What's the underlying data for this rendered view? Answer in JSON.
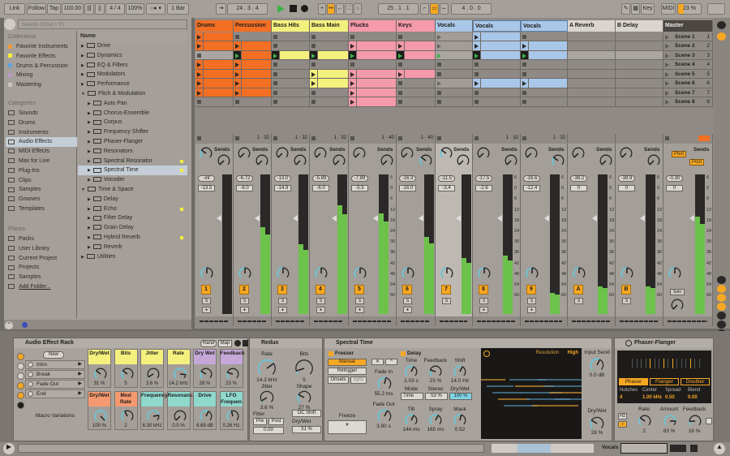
{
  "colors": {
    "orange": "#f36f24",
    "yellow": "#f4f07e",
    "pink": "#f59aaa",
    "blue": "#a9c7e8",
    "return": "#d9d4cf",
    "master": "#4b4642",
    "accent": "#f7a823",
    "meter": "#6cc24a"
  },
  "toolbar": {
    "link": "Link",
    "follow": "Follow",
    "tap": "Tap",
    "tempo": "100.00",
    "signature": "4 / 4",
    "zoom": "100%",
    "quantize": "1 Bar",
    "position": "24 .  3 .  4",
    "loop_start": "25 .  1 .  1",
    "loop_length": "4 .  0 .  0",
    "key": "Key",
    "midi": "MIDI",
    "cpu": "23 %"
  },
  "browser": {
    "search_placeholder": "Search (Cmd + F)",
    "collections_label": "Collections",
    "collections": [
      {
        "label": "Favorite Instruments",
        "color": "#f39a3a"
      },
      {
        "label": "Favorite Effects",
        "color": "#f3ee3a"
      },
      {
        "label": "Drums & Percussion",
        "color": "#5fa3d9"
      },
      {
        "label": "Mixing",
        "color": "#b79ac6"
      },
      {
        "label": "Mastering",
        "color": "#c9c3bd"
      }
    ],
    "categories_label": "Categories",
    "categories": [
      {
        "label": "Sounds",
        "icon": "note-icon"
      },
      {
        "label": "Drums",
        "icon": "grid-icon"
      },
      {
        "label": "Instruments",
        "icon": "clock-icon"
      },
      {
        "label": "Audio Effects",
        "icon": "waveform-icon",
        "selected": true
      },
      {
        "label": "MIDI Effects",
        "icon": "midi-icon"
      },
      {
        "label": "Max for Live",
        "icon": "max-icon"
      },
      {
        "label": "Plug-Ins",
        "icon": "plug-icon"
      },
      {
        "label": "Clips",
        "icon": "clip-icon"
      },
      {
        "label": "Samples",
        "icon": "sample-icon"
      },
      {
        "label": "Grooves",
        "icon": "groove-icon"
      },
      {
        "label": "Templates",
        "icon": "template-icon"
      }
    ],
    "places_label": "Places",
    "places": [
      {
        "label": "Packs"
      },
      {
        "label": "User Library"
      },
      {
        "label": "Current Project"
      },
      {
        "label": "Projects"
      },
      {
        "label": "Samples"
      },
      {
        "label": "Add Folder..."
      }
    ],
    "name_header": "Name",
    "items": [
      {
        "label": "Drive",
        "level": 0,
        "type": "folder"
      },
      {
        "label": "Dynamics",
        "level": 0,
        "type": "folder"
      },
      {
        "label": "EQ & Filters",
        "level": 0,
        "type": "folder"
      },
      {
        "label": "Modulators",
        "level": 0,
        "type": "folder"
      },
      {
        "label": "Performance",
        "level": 0,
        "type": "folder"
      },
      {
        "label": "Pitch & Modulation",
        "level": 0,
        "type": "folder",
        "open": true
      },
      {
        "label": "Auto Pan",
        "level": 1
      },
      {
        "label": "Chorus-Ensemble",
        "level": 1
      },
      {
        "label": "Corpus",
        "level": 1
      },
      {
        "label": "Frequency Shifter",
        "level": 1
      },
      {
        "label": "Phaser-Flanger",
        "level": 1
      },
      {
        "label": "Resonators",
        "level": 1
      },
      {
        "label": "Spectral Resonator",
        "level": 1,
        "new": true
      },
      {
        "label": "Spectral Time",
        "level": 1,
        "new": true,
        "selected": true
      },
      {
        "label": "Vocoder",
        "level": 1
      },
      {
        "label": "Time & Space",
        "level": 0,
        "type": "folder",
        "open": true
      },
      {
        "label": "Delay",
        "level": 1
      },
      {
        "label": "Echo",
        "level": 1,
        "new": true
      },
      {
        "label": "Filter Delay",
        "level": 1
      },
      {
        "label": "Grain Delay",
        "level": 1
      },
      {
        "label": "Hybrid Reverb",
        "level": 1,
        "new": true
      },
      {
        "label": "Reverb",
        "level": 1
      },
      {
        "label": "Utilities",
        "level": 0,
        "type": "folder"
      }
    ]
  },
  "tracks": [
    {
      "name": "Drums",
      "color": "orange",
      "slots": "ppeppppss",
      "vol": "-inf",
      "pan": "-13.5",
      "num": "1",
      "meter": 0,
      "io": ""
    },
    {
      "name": "Percussion",
      "color": "orange",
      "slots": "spPppppss",
      "vol": "-6.72",
      "pan": "-6.0",
      "num": "2",
      "meter": 0.62,
      "io": "1 · 32"
    },
    {
      "name": "Bass Hits",
      "color": "yellow",
      "slots": "ssPsssss",
      "vol": "-13.0",
      "pan": "-14.9",
      "num": "3",
      "meter": 0.5,
      "io": "1 · 32"
    },
    {
      "name": "Bass Main",
      "color": "yellow",
      "slots": "ssPsppss",
      "vol": "-5.89",
      "pan": "-6.0",
      "num": "4",
      "meter": 0.78,
      "io": "1 · 32"
    },
    {
      "name": "Plucks",
      "color": "pink",
      "slots": "spPspppp",
      "vol": "-7.89",
      "pan": "-5.5",
      "num": "5",
      "meter": 0.72,
      "io": "1 · 40",
      "ticks": true
    },
    {
      "name": "Keys",
      "color": "pink",
      "slots": "spPspsss",
      "vol": "-16.3",
      "pan": "-16.0",
      "num": "6",
      "meter": 0.55,
      "io": "1 · 40"
    },
    {
      "name": "Vocals",
      "color": "blue",
      "slots": "ggGssgss",
      "vol": "-11.5",
      "pan": "-3.4",
      "num": "7",
      "meter": 0.4,
      "io": "",
      "group": true
    },
    {
      "name": "Vocals",
      "color": "blue",
      "slots": "ppPsspss",
      "vol": "-17.5",
      "pan": "-2.6",
      "num": "8",
      "meter": 0.42,
      "io": "1 · 32",
      "ticks": true
    },
    {
      "name": "Vocals",
      "color": "blue",
      "slots": "spPsspss",
      "vol": "-16.6",
      "pan": "-12.4",
      "num": "9",
      "meter": 0.15,
      "io": "1 · 32",
      "ticks": true
    },
    {
      "name": "A Reverb",
      "color": "return",
      "slots": "",
      "vol": "-36.2",
      "pan": "0",
      "num": "A",
      "meter": 0.2,
      "io": "",
      "ticks": true
    },
    {
      "name": "B Delay",
      "color": "return",
      "slots": "",
      "vol": "-38.9",
      "pan": "0",
      "num": "B",
      "meter": 0.2,
      "io": "",
      "ticks": true
    },
    {
      "name": "Master",
      "color": "master",
      "slots": "",
      "vol": "-0.30",
      "pan": "0",
      "num": "",
      "meter": 0.7,
      "io": "",
      "ticks": true,
      "master": true
    }
  ],
  "scenes": [
    "Scene 1",
    "Scene 2",
    "Scene 3",
    "Scene 4",
    "Scene 5",
    "Scene 6",
    "Scene 7",
    "Scene 8"
  ],
  "scene_numbers": [
    "1",
    "2",
    "3",
    "4",
    "5",
    "6",
    "7",
    "8"
  ],
  "mixer": {
    "sends_label": "Sends",
    "solo_label": "S",
    "post_label": "Post",
    "master_solo": "Solo",
    "ticks": [
      "6",
      "0",
      "6",
      "12",
      "18",
      "24",
      "30",
      "36",
      "42",
      "48",
      "54",
      "60"
    ]
  },
  "rack": {
    "title": "Audio Effect Rack",
    "rand": "Rand",
    "map": "Map",
    "new": "New",
    "variations": [
      "Intro",
      "Break",
      "Fade Out",
      "End"
    ],
    "variations_label": "Macro Variations",
    "macros": [
      {
        "label": "Dry/Wet",
        "value": "31 %",
        "color": "#f4f07e",
        "f": 0.31
      },
      {
        "label": "Bits",
        "value": "5",
        "color": "#f4f07e",
        "f": 0.3
      },
      {
        "label": "Jitter",
        "value": "3.6 %",
        "color": "#f4f07e",
        "f": 0.05
      },
      {
        "label": "Rate",
        "value": "14.2 kHz",
        "color": "#f4f07e",
        "f": 0.85
      },
      {
        "label": "Dry Wet",
        "value": "28 %",
        "color": "#c5a7d8",
        "f": 0.28
      },
      {
        "label": "Feedback",
        "value": "23 %",
        "color": "#c5a7d8",
        "f": 0.23
      },
      {
        "label": "Dry/Wet",
        "value": "100 %",
        "color": "#f59a70",
        "f": 1
      },
      {
        "label": "Mod Rate",
        "value": "2",
        "color": "#f59a70",
        "f": 0.4
      },
      {
        "label": "Frequency",
        "value": "6.30 kHz",
        "color": "#8fd8cc",
        "f": 0.8
      },
      {
        "label": "Resonance",
        "value": "0.0 %",
        "color": "#8fd8cc",
        "f": 0
      },
      {
        "label": "Drive",
        "value": "8.69 dB",
        "color": "#8fd8cc",
        "f": 0.6
      },
      {
        "label": "LFO Frequen",
        "value": "0.26 Hz",
        "color": "#8fd8cc",
        "f": 0.45
      }
    ]
  },
  "redux": {
    "title": "Redux",
    "rate_label": "Rate",
    "rate": "14.2 kHz",
    "bits_label": "Bits",
    "bits": "5",
    "jitter_label": "Jitter",
    "jitter": "3.6 %",
    "shape_label": "Shape",
    "shape": "27 %",
    "filter_label": "Filter",
    "pre": "Pre",
    "post": "Post",
    "filter_value": "0.00",
    "dc_shift": "DC Shift",
    "drywet_label": "Dry/Wet",
    "drywet": "31 %"
  },
  "spectral": {
    "title": "Spectral Time",
    "freezer": "Freezer",
    "manual": "Manual",
    "retrigger": "Retrigger",
    "onsets": "Onsets",
    "sync": "Sync",
    "fade_in_label": "Fade In",
    "fade_in": "55.2 ms",
    "fade_out_label": "Fade Out",
    "fade_out": "3.90 s",
    "freeze_label": "Freeze",
    "freeze_glyph": "*",
    "delay": "Delay",
    "time_label": "Time",
    "time": "1.03 s",
    "feedback_label": "Feedback",
    "feedback": "23 %",
    "shift_label": "Shift",
    "shift": "14.0 Hz",
    "mode_label": "Mode",
    "mode": "Time",
    "stereo_label": "Stereo",
    "stereo": "53 %",
    "drywet_label": "Dry/Wet",
    "drywet": "100 %",
    "tilt_label": "Tilt",
    "tilt": "144 ms",
    "spray_label": "Spray",
    "spray": "165 ms",
    "mask_label": "Mask",
    "mask": "0.52",
    "resolution_label": "Resolution",
    "resolution": "High",
    "input_send_label": "Input Send",
    "input_send": "0.0 dB",
    "out_drywet_label": "Dry/Wet",
    "out_drywet": "28 %"
  },
  "phaser": {
    "title": "Phaser-Flanger",
    "modes": [
      "Phaser",
      "Flanger",
      "Doubler"
    ],
    "active_mode": "Phaser",
    "params": [
      {
        "label": "Notches",
        "value": "4"
      },
      {
        "label": "Center",
        "value": "1.00 kHz"
      },
      {
        "label": "Spread",
        "value": "0.50"
      },
      {
        "label": "Blend",
        "value": "0.00"
      }
    ],
    "hz": "Hz",
    "rate_label": "Rate",
    "rate": "2",
    "amount_label": "Amount",
    "amount": "83 %",
    "feedback_label": "Feedback",
    "feedback": "16 %"
  },
  "status": {
    "track": "Vocals"
  }
}
